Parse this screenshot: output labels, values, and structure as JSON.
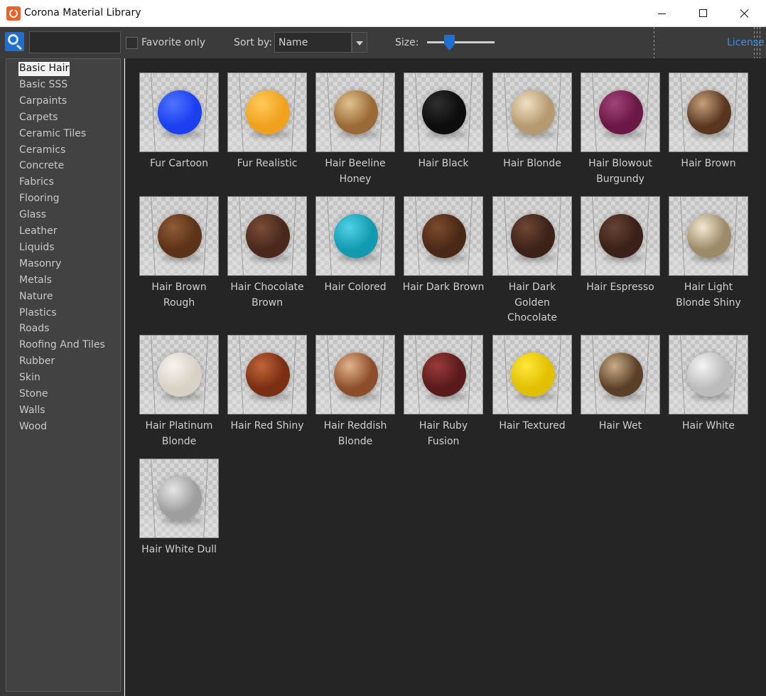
{
  "window": {
    "title": "Corona Material Library"
  },
  "toolbar": {
    "search_value": "",
    "favorite_label": "Favorite only",
    "sort_label": "Sort by:",
    "sort_value": "Name",
    "size_label": "Size:",
    "size_level": 0.3,
    "license_label": "License"
  },
  "sidebar": {
    "categories": [
      "Basic Hair",
      "Basic SSS",
      "Carpaints",
      "Carpets",
      "Ceramic Tiles",
      "Ceramics",
      "Concrete",
      "Fabrics",
      "Flooring",
      "Glass",
      "Leather",
      "Liquids",
      "Masonry",
      "Metals",
      "Nature",
      "Plastics",
      "Roads",
      "Roofing And Tiles",
      "Rubber",
      "Skin",
      "Stone",
      "Walls",
      "Wood"
    ],
    "selected": "Basic Hair"
  },
  "materials": [
    {
      "name": "Fur Cartoon",
      "color": "#1a40f0",
      "hi": "#4f73ff"
    },
    {
      "name": "Fur Realistic",
      "color": "#f0a21e",
      "hi": "#ffc95a"
    },
    {
      "name": "Hair Beeline Honey",
      "color": "#9a6a35",
      "hi": "#e1c28e"
    },
    {
      "name": "Hair Black",
      "color": "#0d0d0d",
      "hi": "#2e2e2e"
    },
    {
      "name": "Hair Blonde",
      "color": "#b59a70",
      "hi": "#efe0c4"
    },
    {
      "name": "Hair Blowout Burgundy",
      "color": "#6a1846",
      "hi": "#a24377"
    },
    {
      "name": "Hair Brown",
      "color": "#5a3620",
      "hi": "#c6a07a"
    },
    {
      "name": "Hair Brown Rough",
      "color": "#5c3218",
      "hi": "#8e5c35"
    },
    {
      "name": "Hair Chocolate Brown",
      "color": "#4a281c",
      "hi": "#7a4c36"
    },
    {
      "name": "Hair Colored",
      "color": "#129ab0",
      "hi": "#4ed1e6"
    },
    {
      "name": "Hair Dark Brown",
      "color": "#4a2816",
      "hi": "#7a4a2c"
    },
    {
      "name": "Hair Dark Golden Chocolate",
      "color": "#3c2218",
      "hi": "#6e4634"
    },
    {
      "name": "Hair Espresso",
      "color": "#3a2018",
      "hi": "#664234"
    },
    {
      "name": "Hair Light Blonde Shiny",
      "color": "#9c8a68",
      "hi": "#f2e8d2"
    },
    {
      "name": "Hair Platinum Blonde",
      "color": "#d8d2c6",
      "hi": "#f6f4ee"
    },
    {
      "name": "Hair Red Shiny",
      "color": "#7a2e12",
      "hi": "#c0653a"
    },
    {
      "name": "Hair Reddish Blonde",
      "color": "#8c4e2a",
      "hi": "#e2b48a"
    },
    {
      "name": "Hair Ruby Fusion",
      "color": "#5a1a1c",
      "hi": "#9a3a3a"
    },
    {
      "name": "Hair Textured",
      "color": "#e0c000",
      "hi": "#ffe63a"
    },
    {
      "name": "Hair Wet",
      "color": "#5a4028",
      "hi": "#c9ad88"
    },
    {
      "name": "Hair White",
      "color": "#bcbcbc",
      "hi": "#f4f4f4"
    },
    {
      "name": "Hair White Dull",
      "color": "#9e9e9e",
      "hi": "#e6e6e6"
    }
  ],
  "materials_labels": {
    "Fur Cartoon": [
      "Fur Cartoon"
    ],
    "Fur Realistic": [
      "Fur Realistic"
    ],
    "Hair Beeline Honey": [
      "Hair Beeline",
      "Honey"
    ],
    "Hair Black": [
      "Hair Black"
    ],
    "Hair Blonde": [
      "Hair Blonde"
    ],
    "Hair Blowout Burgundy": [
      "Hair Blowout",
      "Burgundy"
    ],
    "Hair Brown": [
      "Hair Brown"
    ],
    "Hair Brown Rough": [
      "Hair Brown",
      "Rough"
    ],
    "Hair Chocolate Brown": [
      "Hair Chocolate",
      "Brown"
    ],
    "Hair Colored": [
      "Hair Colored"
    ],
    "Hair Dark Brown": [
      "Hair Dark Brown"
    ],
    "Hair Dark Golden Chocolate": [
      "Hair Dark",
      "Golden",
      "Chocolate"
    ],
    "Hair Espresso": [
      "Hair Espresso"
    ],
    "Hair Light Blonde Shiny": [
      "Hair Light",
      "Blonde Shiny"
    ],
    "Hair Platinum Blonde": [
      "Hair Platinum",
      "Blonde"
    ],
    "Hair Red Shiny": [
      "Hair Red Shiny"
    ],
    "Hair Reddish Blonde": [
      "Hair Reddish",
      "Blonde"
    ],
    "Hair Ruby Fusion": [
      "Hair Ruby",
      "Fusion"
    ],
    "Hair Textured": [
      "Hair Textured"
    ],
    "Hair Wet": [
      "Hair Wet"
    ],
    "Hair White": [
      "Hair White"
    ],
    "Hair White Dull": [
      "Hair White Dull"
    ]
  }
}
